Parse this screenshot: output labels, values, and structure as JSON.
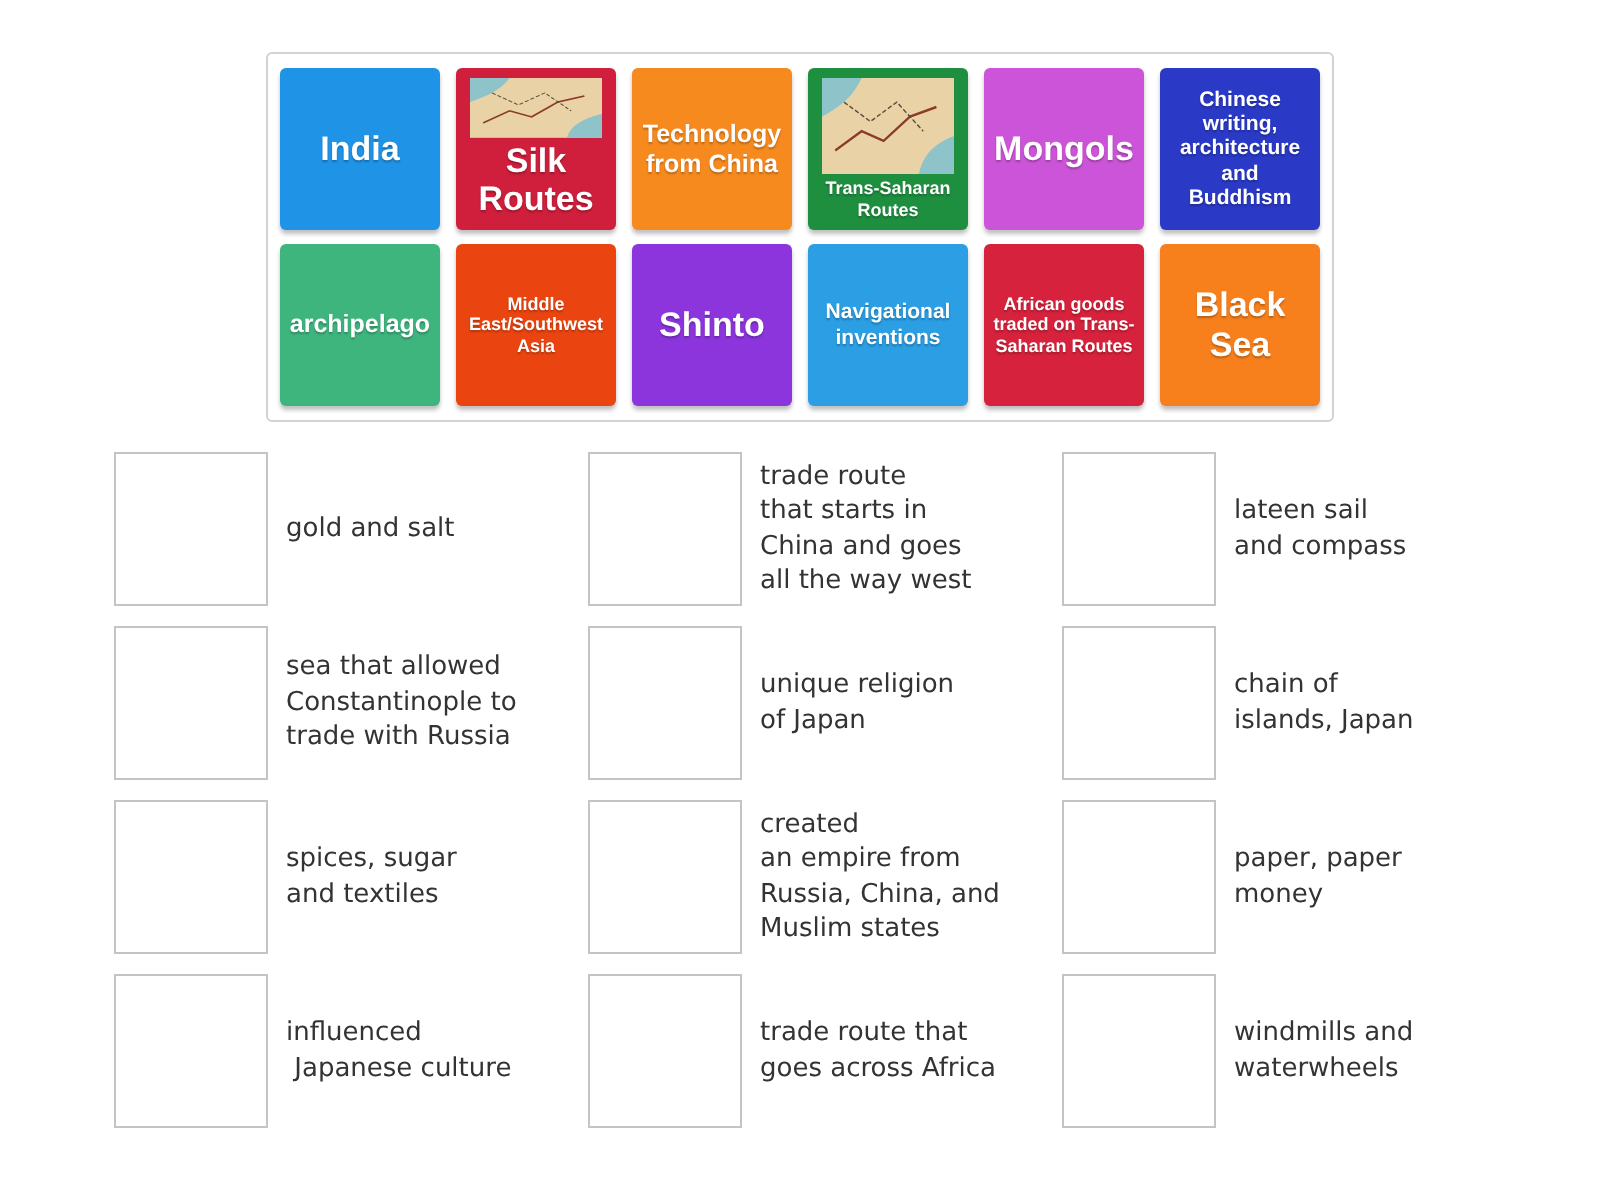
{
  "tiles": [
    {
      "text": "India",
      "color": "#1f93e6",
      "picture": false
    },
    {
      "text": "Silk Routes",
      "color": "#cf1f3c",
      "picture": true
    },
    {
      "text": "Technology from China",
      "color": "#f78a1f",
      "picture": false
    },
    {
      "text": "Trans-Saharan Routes",
      "color": "#1e8f3f",
      "picture": true
    },
    {
      "text": "Mongols",
      "color": "#cc54d8",
      "picture": false
    },
    {
      "text": "Chinese writing, architecture and Buddhism",
      "color": "#2a3ac6",
      "picture": false
    },
    {
      "text": "archipelago",
      "color": "#3fb57e",
      "picture": false
    },
    {
      "text": "Middle East/Southwest Asia",
      "color": "#ea4510",
      "picture": false
    },
    {
      "text": "Shinto",
      "color": "#8c35dc",
      "picture": false
    },
    {
      "text": "Navigational inventions",
      "color": "#2b9ee4",
      "picture": false
    },
    {
      "text": "African goods traded on Trans-Saharan Routes",
      "color": "#d6223c",
      "picture": false
    },
    {
      "text": "Black Sea",
      "color": "#f7801c",
      "picture": false
    }
  ],
  "definitions": [
    "gold and salt",
    "trade route\nthat starts in\nChina and goes\nall the way west",
    "lateen sail\nand compass",
    "sea that allowed\nConstantinople to\ntrade with Russia",
    "unique religion\nof Japan",
    "chain of\nislands, Japan",
    "spices, sugar\nand textiles",
    "created\nan empire from\nRussia, China, and\nMuslim states",
    "paper, paper\nmoney",
    "influenced\n Japanese culture",
    "trade route that\ngoes across Africa",
    "windmills and\nwaterwheels"
  ]
}
